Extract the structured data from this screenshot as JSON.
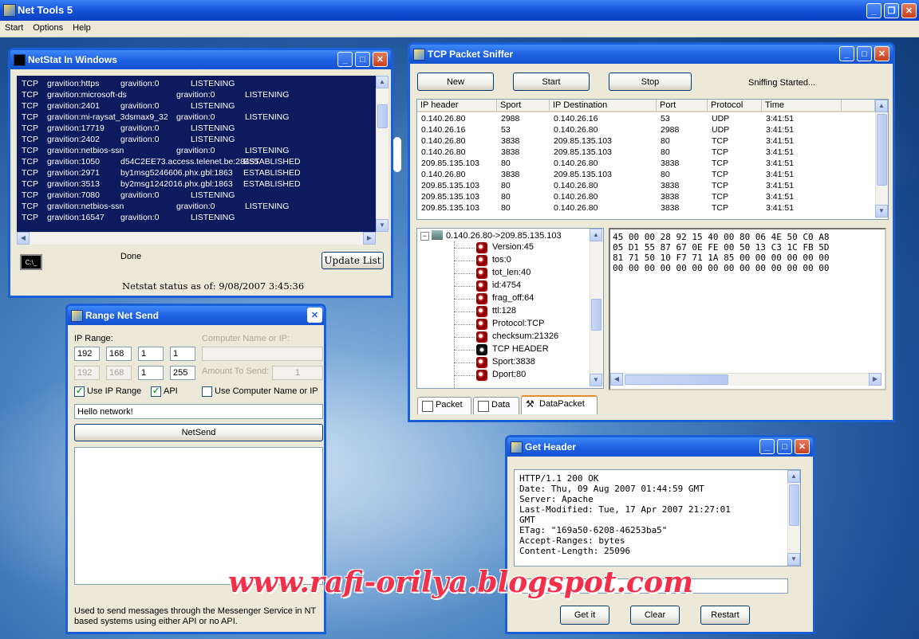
{
  "app": {
    "title": "Net Tools 5",
    "menu": [
      "Start",
      "Options",
      "Help"
    ]
  },
  "netstat": {
    "title": "NetStat In Windows",
    "rows": [
      [
        "TCP",
        "gravition:https",
        "gravition:0",
        "LISTENING"
      ],
      [
        "TCP",
        "gravition:microsoft-ds",
        "gravition:0",
        "LISTENING"
      ],
      [
        "TCP",
        "gravition:2401",
        "gravition:0",
        "LISTENING"
      ],
      [
        "TCP",
        "gravition:mi-raysat_3dsmax9_32",
        "gravition:0",
        "LISTENING"
      ],
      [
        "TCP",
        "gravition:17719",
        "gravition:0",
        "LISTENING"
      ],
      [
        "TCP",
        "gravition:2402",
        "gravition:0",
        "LISTENING"
      ],
      [
        "TCP",
        "gravition:netbios-ssn",
        "gravition:0",
        "LISTENING"
      ],
      [
        "TCP",
        "gravition:1050",
        "d54C2EE73.access.telenet.be:28455",
        "ESTABLISHED"
      ],
      [
        "TCP",
        "gravition:2971",
        "by1msg5246606.phx.gbl:1863",
        "ESTABLISHED"
      ],
      [
        "TCP",
        "gravition:3513",
        "by2msg1242016.phx.gbl:1863",
        "ESTABLISHED"
      ],
      [
        "TCP",
        "gravition:7080",
        "gravition:0",
        "LISTENING"
      ],
      [
        "TCP",
        "gravition:netbios-ssn",
        "gravition:0",
        "LISTENING"
      ],
      [
        "TCP",
        "gravition:16547",
        "gravition:0",
        "LISTENING"
      ]
    ],
    "status_text": "Done",
    "update_button": "Update List",
    "netstat_status": "Netstat status as of: 9/08/2007 3:45:36"
  },
  "sniffer": {
    "title": "TCP Packet Sniffer",
    "new_button": "New",
    "start_button": "Start",
    "stop_button": "Stop",
    "status": "Sniffing Started...",
    "columns": [
      "IP header",
      "Sport",
      "IP Destination",
      "Port",
      "Protocol",
      "Time"
    ],
    "rows": [
      [
        "0.140.26.80",
        "2988",
        "0.140.26.16",
        "53",
        "UDP",
        "3:41:51"
      ],
      [
        "0.140.26.16",
        "53",
        "0.140.26.80",
        "2988",
        "UDP",
        "3:41:51"
      ],
      [
        "0.140.26.80",
        "3838",
        "209.85.135.103",
        "80",
        "TCP",
        "3:41:51"
      ],
      [
        "0.140.26.80",
        "3838",
        "209.85.135.103",
        "80",
        "TCP",
        "3:41:51"
      ],
      [
        "209.85.135.103",
        "80",
        "0.140.26.80",
        "3838",
        "TCP",
        "3:41:51"
      ],
      [
        "0.140.26.80",
        "3838",
        "209.85.135.103",
        "80",
        "TCP",
        "3:41:51"
      ],
      [
        "209.85.135.103",
        "80",
        "0.140.26.80",
        "3838",
        "TCP",
        "3:41:51"
      ],
      [
        "209.85.135.103",
        "80",
        "0.140.26.80",
        "3838",
        "TCP",
        "3:41:51"
      ],
      [
        "209.85.135.103",
        "80",
        "0.140.26.80",
        "3838",
        "TCP",
        "3:41:51"
      ]
    ],
    "tree_root": "0.140.26.80->209.85.135.103",
    "tree_items": [
      "Version:45",
      "tos:0",
      "tot_len:40",
      "id:4754",
      "frag_off:64",
      "ttl:128",
      "Protocol:TCP",
      "checksum:21326",
      "TCP HEADER",
      "Sport:3838",
      "Dport:80"
    ],
    "hex_lines": [
      "45 00 00 28 92 15 40 00 80 06 4E 50 C0 A8",
      "05 D1 55 87 67 0E FE 00 50 13 C3 1C FB 5D",
      "81 71 50 10 F7 71 1A 85 00 00 00 00 00 00",
      "00 00 00 00 00 00 00 00 00 00 00 00 00 00"
    ],
    "tabs": [
      "Packet",
      "Data",
      "DataPacket"
    ]
  },
  "range": {
    "title": "Range Net Send",
    "ip_range_label": "IP Range:",
    "ip_from": [
      "192",
      "168",
      "1",
      "1"
    ],
    "ip_to": [
      "192",
      "168",
      "1",
      "255"
    ],
    "computer_label": "Computer Name or IP:",
    "amount_label": "Amount To Send:",
    "amount_value": "1",
    "use_ip_range": "Use IP Range",
    "api": "API",
    "use_computer": "Use Computer Name or IP",
    "message": "Hello network!",
    "netsend_button": "NetSend",
    "description": "Used to send messages through the Messenger Service in NT based systems using either API or no API."
  },
  "header": {
    "title": "Get Header",
    "lines": [
      "HTTP/1.1 200 OK",
      "Date: Thu, 09 Aug 2007 01:44:59 GMT",
      "Server: Apache",
      "Last-Modified: Tue, 17 Apr 2007 21:27:01",
      "GMT",
      "ETag: \"169a50-6208-46253ba5\"",
      "Accept-Ranges: bytes",
      "Content-Length: 25096"
    ],
    "getit_button": "Get it",
    "clear_button": "Clear",
    "restart_button": "Restart"
  },
  "watermark": "www.rafi-orilya.blogspot.com"
}
